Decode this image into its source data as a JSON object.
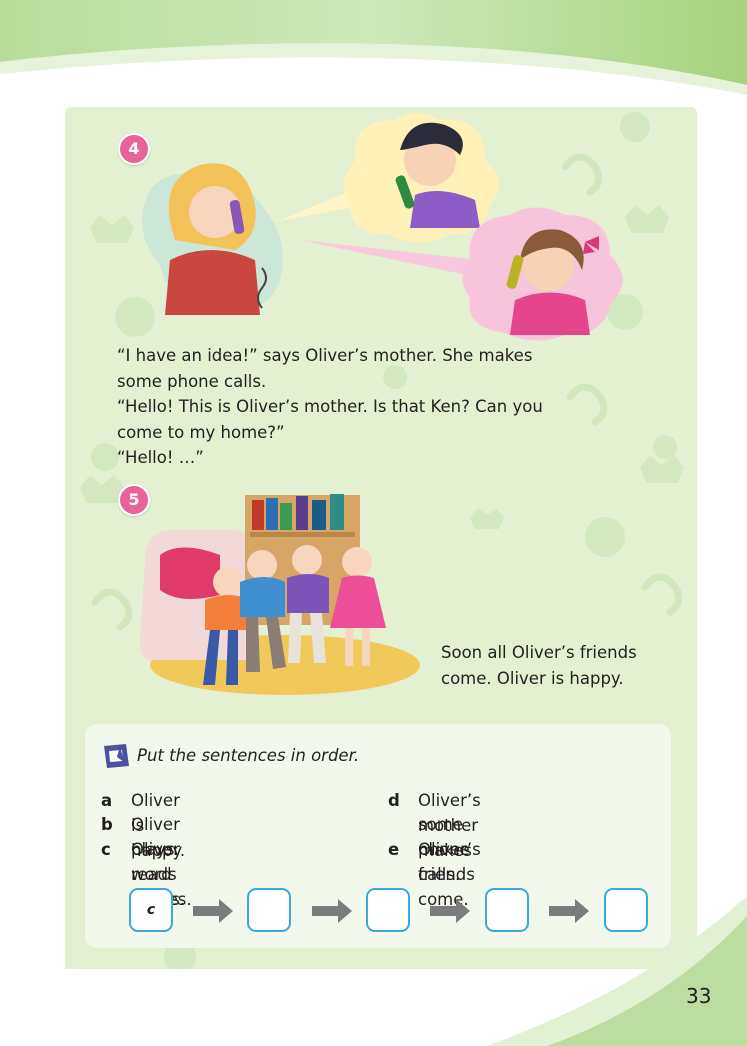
{
  "page_number": "33",
  "badges": {
    "scene4": "4",
    "scene5": "5"
  },
  "story": {
    "para1_line1": "“I have an idea!” says Oliver’s mother. She makes",
    "para1_line2": "some phone calls.",
    "para2_line1": "“Hello! This is Oliver’s mother. Is that Ken? Can you",
    "para2_line2": "come to my home?”",
    "para3": "“Hello! …”",
    "caption_line1": "Soon all Oliver’s friends",
    "caption_line2": "come. Oliver is happy."
  },
  "exercise": {
    "icon": "pencil-note-icon",
    "instruction": "Put the sentences in order.",
    "items": [
      {
        "letter": "a",
        "text": "Oliver is happy."
      },
      {
        "letter": "b",
        "text": "Oliver plays word games."
      },
      {
        "letter": "c",
        "text": "Oliver reads books."
      },
      {
        "letter": "d",
        "text": "Oliver’s mother makes",
        "text2": "some phone calls."
      },
      {
        "letter": "e",
        "text": "Oliver’s friends come."
      }
    ],
    "answers": [
      "c",
      "",
      "",
      "",
      ""
    ]
  },
  "colors": {
    "panel": "#e3f0d2",
    "badge": "#e8639a",
    "box_border": "#3aa9d9",
    "arrow": "#7b7c7e"
  }
}
